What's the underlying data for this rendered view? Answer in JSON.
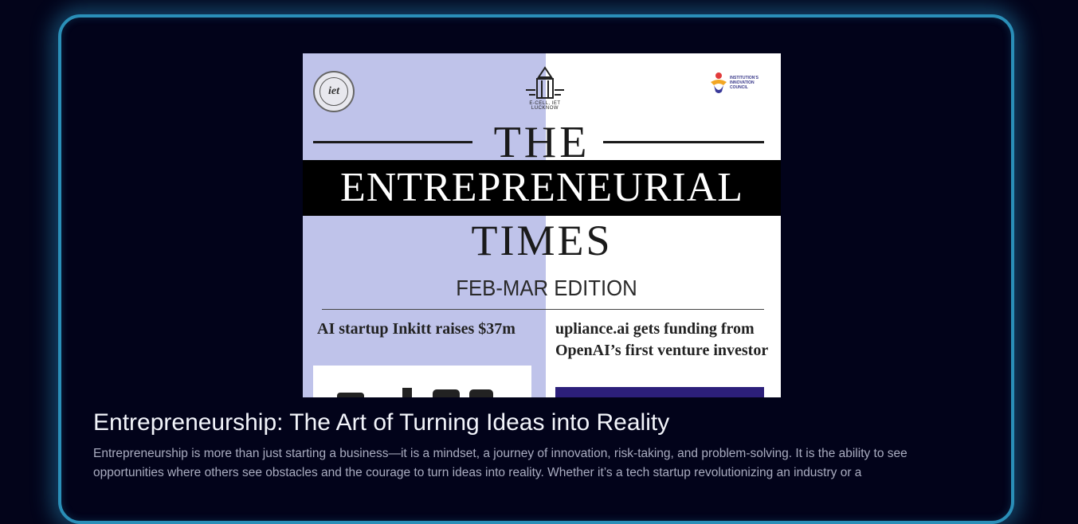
{
  "article": {
    "title": "Entrepreneurship: The Art of Turning Ideas into Reality",
    "description": "Entrepreneurship is more than just starting a business—it is a mindset, a journey of innovation, risk-taking, and problem-solving. It is the ability to see opportunities where others see obstacles and the courage to turn ideas into reality. Whether it’s a tech startup revolutionizing an industry or a"
  },
  "poster": {
    "logo_left_text": "iet",
    "logo_center_caption": "E-CELL, IET LUCKNOW",
    "logo_right_text": "INSTITUTION'S INNOVATION COUNCIL",
    "the": "THE",
    "entrepreneurial": "ENTREPRENEURIAL",
    "times": "TIMES",
    "edition": "FEB-MAR EDITION",
    "headline_left": "AI startup Inkitt raises $37m",
    "headline_right": "upliance.ai gets funding from OpenAI’s first venture investor"
  },
  "colors": {
    "background": "#03041a",
    "card_border": "#2a8fb8",
    "poster_left": "#bfc3ea",
    "title": "#f2f4fa",
    "description": "#a9acc0"
  }
}
